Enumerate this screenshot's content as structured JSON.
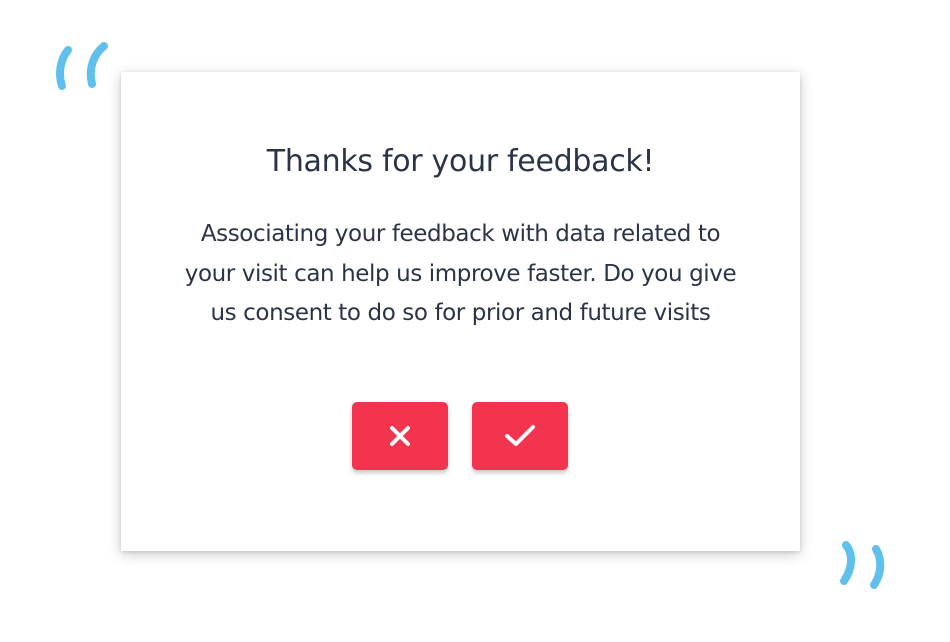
{
  "dialog": {
    "title": "Thanks for your feedback!",
    "message": "Associating your feedback with data related to your visit can help us improve faster. Do you give us consent to do so for prior and future visits"
  },
  "buttons": {
    "decline_icon": "close-icon",
    "accept_icon": "checkmark-icon"
  },
  "decorations": {
    "open_quote_icon": "open-quote-icon",
    "close_quote_icon": "close-quote-icon"
  },
  "colors": {
    "accent": "#f2344e",
    "quote": "#5fc0ee",
    "text": "#2b3447",
    "card": "#ffffff"
  }
}
